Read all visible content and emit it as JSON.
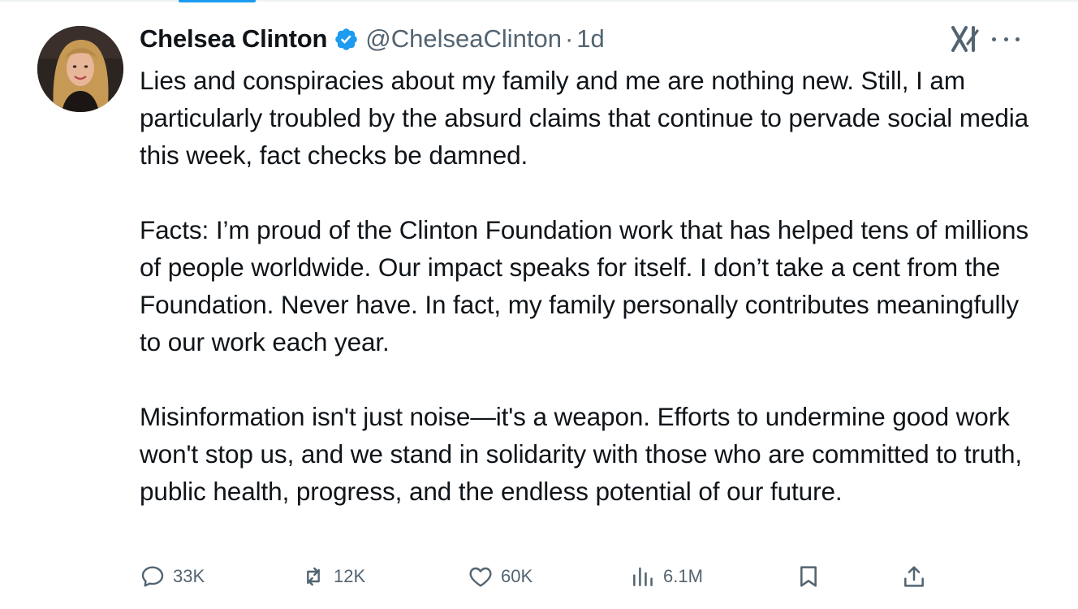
{
  "author": {
    "name": "Chelsea Clinton",
    "handle": "@ChelseaClinton",
    "separator": "·",
    "time": "1d",
    "verified": true
  },
  "post": {
    "paragraphs": [
      "Lies and conspiracies about my family and me are nothing new. Still, I am particularly troubled by the absurd claims that continue to pervade social media this week, fact checks be damned.",
      "Facts: I’m proud of the Clinton Foundation work that has helped tens of millions of people worldwide. Our impact speaks for itself. I don’t take a cent from the Foundation. Never have. In fact, my family personally contributes meaningfully to our work each year.",
      "Misinformation isn't just noise—it's a weapon. Efforts to undermine good work won't stop us, and we stand in solidarity with those who are committed to truth, public health, progress, and the endless potential of our future."
    ]
  },
  "actions": {
    "replies": "33K",
    "reposts": "12K",
    "likes": "60K",
    "views": "6.1M"
  },
  "icons": {
    "verified": "verified-badge-icon",
    "grok": "grok-icon",
    "more": "more-icon",
    "reply": "reply-icon",
    "repost": "repost-icon",
    "like": "like-icon",
    "views": "views-icon",
    "bookmark": "bookmark-icon",
    "share": "share-icon"
  },
  "colors": {
    "text": "#0f1419",
    "secondary": "#536471",
    "accent": "#1d9bf0",
    "background": "#ffffff"
  }
}
